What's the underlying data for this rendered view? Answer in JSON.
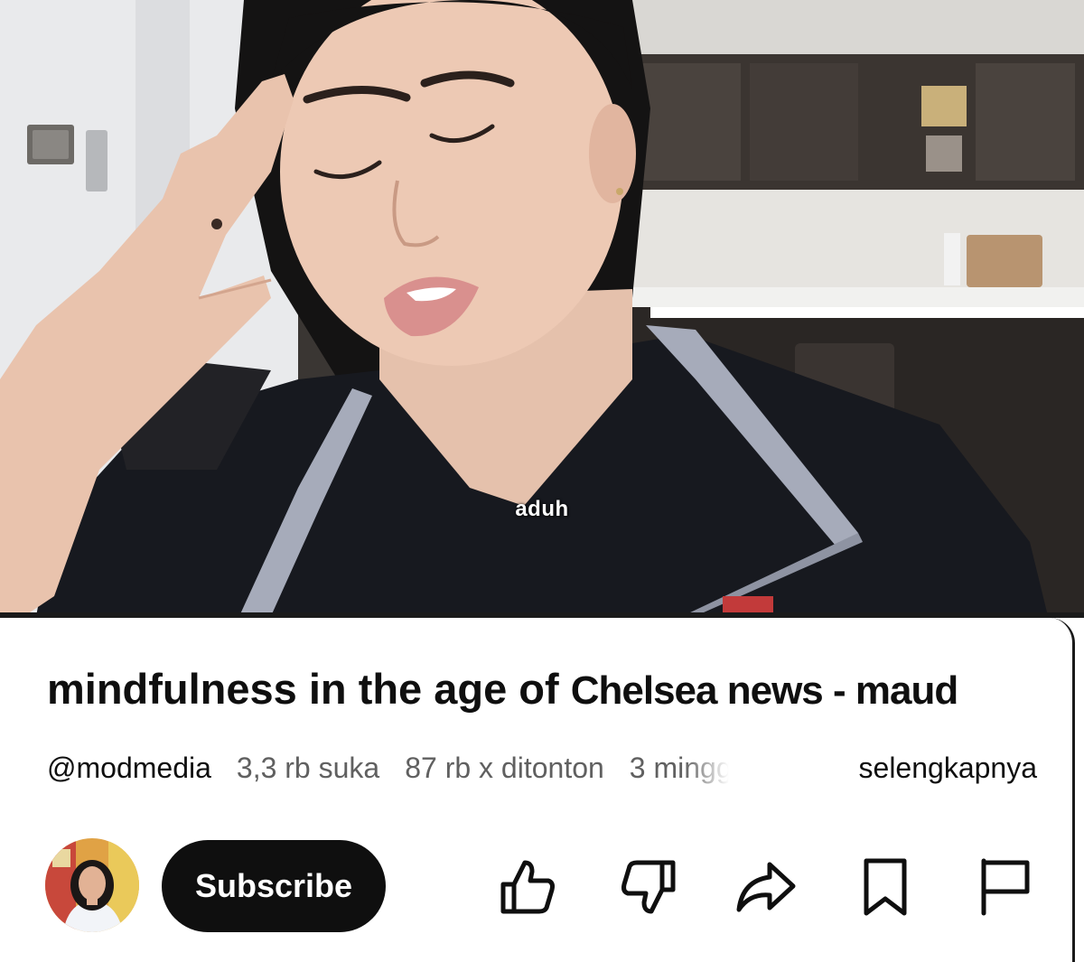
{
  "video": {
    "caption": "aduh"
  },
  "info": {
    "title_main": "mindfulness in the age of ",
    "title_tail": "Chelsea news - maud",
    "channel_handle": "@modmedia",
    "likes": "3,3 rb suka",
    "views": "87 rb x ditonton",
    "time_ago": "3 minggu",
    "more_label": "selengkapnya"
  },
  "actions": {
    "subscribe_label": "Subscribe",
    "icons": [
      "like-icon",
      "dislike-icon",
      "share-icon",
      "save-icon",
      "report-icon"
    ]
  },
  "colors": {
    "text_primary": "#0f0f0f",
    "text_secondary": "#606060",
    "subscribe_bg": "#0f0f0f",
    "subscribe_text": "#ffffff"
  }
}
